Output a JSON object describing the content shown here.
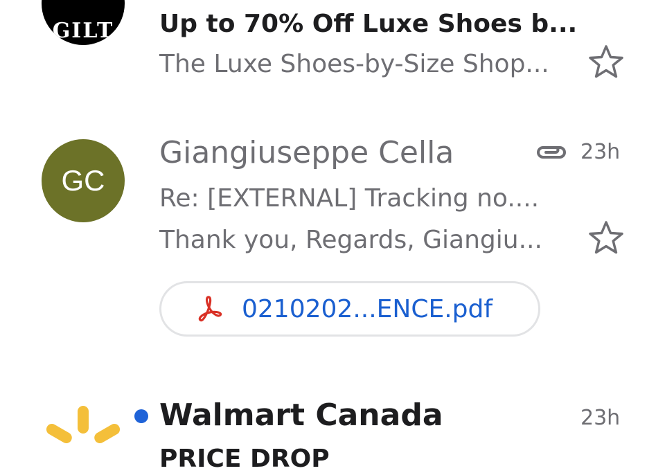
{
  "emails": [
    {
      "avatar_text": "GILT",
      "subject": "Up to 70% Off Luxe Shoes b...",
      "preview": "The Luxe Shoes-by-Size Shop..."
    },
    {
      "avatar_text": "GC",
      "sender": "Giangiuseppe Cella",
      "time": "23h",
      "subject": "Re: [EXTERNAL] Tracking no....",
      "preview": "Thank you, Regards, Giangiu...",
      "attachment_name": "0210202...ENCE.pdf"
    },
    {
      "sender": "Walmart Canada",
      "time": "23h",
      "subject_partial": "PRICE DROP",
      "unread": true
    }
  ],
  "colors": {
    "unread_dot": "#1f63d8",
    "gc_avatar": "#6c7228",
    "link_blue": "#1a5fd0",
    "walmart_spark": "#f4bf3a",
    "pdf_red": "#d93025"
  },
  "icons": [
    "star-icon",
    "paperclip-icon",
    "pdf-icon",
    "walmart-spark-logo"
  ]
}
